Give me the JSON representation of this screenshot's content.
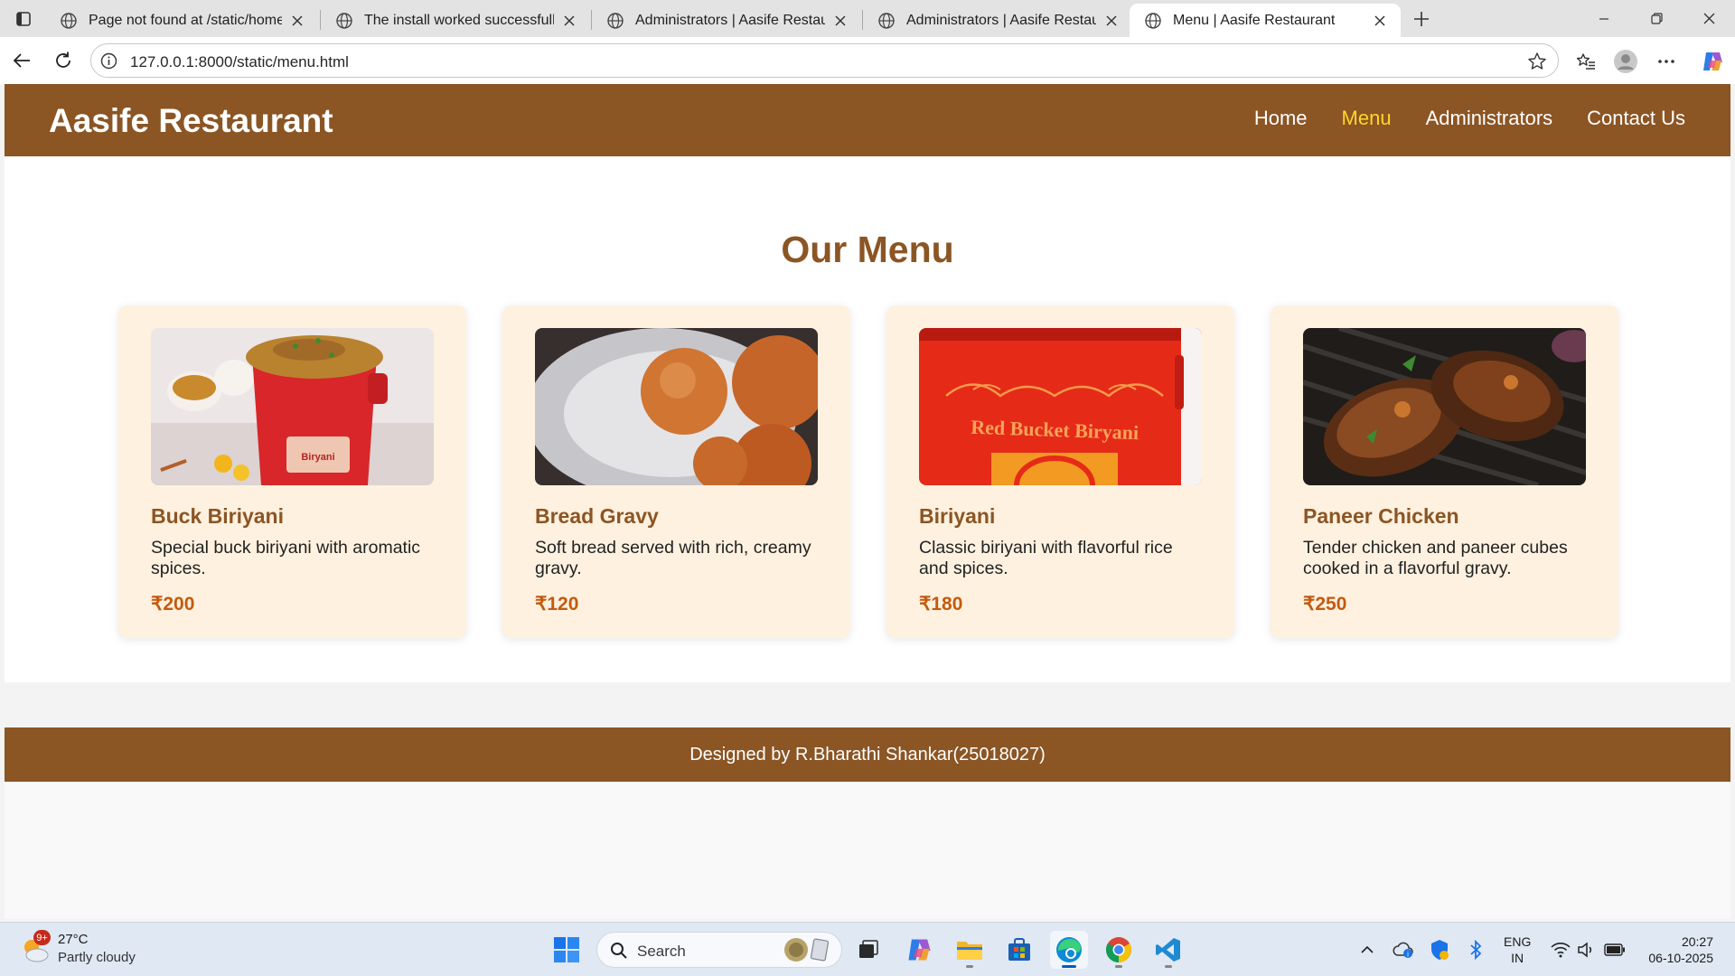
{
  "browser": {
    "tabs": [
      {
        "title": "Page not found at /static/home.ht",
        "active": false
      },
      {
        "title": "The install worked successfully! Co",
        "active": false
      },
      {
        "title": "Administrators | Aasife Restaurant",
        "active": false
      },
      {
        "title": "Administrators | Aasife Restaurant",
        "active": false
      },
      {
        "title": "Menu | Aasife Restaurant",
        "active": true
      }
    ],
    "url": "127.0.0.1:8000/static/menu.html"
  },
  "site": {
    "brand": "Aasife Restaurant",
    "nav": [
      {
        "label": "Home",
        "active": false
      },
      {
        "label": "Menu",
        "active": true
      },
      {
        "label": "Administrators",
        "active": false
      },
      {
        "label": "Contact Us",
        "active": false
      }
    ],
    "menu_title": "Our Menu",
    "items": [
      {
        "name": "Buck Biriyani",
        "description": "Special buck biriyani with aromatic spices.",
        "price": "₹200",
        "image": "biryani-bucket-photo"
      },
      {
        "name": "Bread Gravy",
        "description": "Soft bread served with rich, creamy gravy.",
        "price": "₹120",
        "image": "gulab-jamun-photo"
      },
      {
        "name": "Biriyani",
        "description": "Classic biriyani with flavorful rice and spices.",
        "price": "₹180",
        "image": "red-bucket-photo"
      },
      {
        "name": "Paneer Chicken",
        "description": "Tender chicken and paneer cubes cooked in a flavorful gravy.",
        "price": "₹250",
        "image": "grilled-chicken-photo"
      }
    ],
    "bucket_label": "Red Bucket Biryani",
    "footer": "Designed by R.Bharathi Shankar(25018027)"
  },
  "colors": {
    "brand_brown": "#8b5524",
    "nav_active": "#ffd52a",
    "card_bg": "#fff1df",
    "price": "#c35a10"
  },
  "taskbar": {
    "weather": {
      "temp": "27°C",
      "condition": "Partly cloudy",
      "badge": "9+"
    },
    "search_label": "Search",
    "language": {
      "line1": "ENG",
      "line2": "IN"
    },
    "time": "20:27",
    "date": "06-10-2025"
  }
}
